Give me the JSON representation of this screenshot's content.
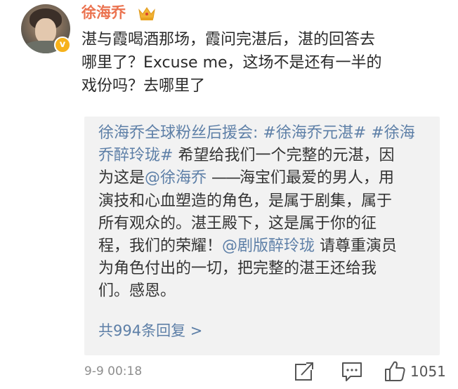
{
  "post": {
    "username": "徐海乔",
    "badge_icon": "crown-icon",
    "verified_icon": "verified-v-icon",
    "text_line1": "湛与霞喝酒那场，霞问完湛后，湛的回答去",
    "text_line2": "哪里了？Excuse me，这场不是还有一半的",
    "text_line3": "戏份吗？去哪里了"
  },
  "quoted": {
    "author": "徐海乔全球粉丝后援会:",
    "hashtag1": "#徐海乔元湛#",
    "hashtag2_part1": "#徐海",
    "hashtag2_part2": "乔醉玲珑#",
    "text_a": "希望给我们一个完整的元湛，因",
    "text_b": "为这是",
    "mention1": "@徐海乔",
    "dash": "——",
    "text_c": "海宝们最爱的男人，用",
    "text_d": "演技和心血塑造的角色，是属于剧集，属于",
    "text_e": "所有观众的。湛王殿下，这是属于你的征",
    "text_f": "程，我们的荣耀！",
    "mention2": "@剧版醉玲珑",
    "text_g": "请尊重演员",
    "text_h": "为角色付出的一切，把完整的湛王还给我",
    "text_i": "们。感恩。",
    "reply_count": "共994条回复 >"
  },
  "footer": {
    "timestamp": "9-9 00:18",
    "share_icon": "share-icon",
    "comment_icon": "comment-icon",
    "like_icon": "like-icon",
    "like_count": "1051"
  },
  "colors": {
    "username": "#eb7350",
    "link": "#5d7fa7",
    "text": "#2a2a2a",
    "card_bg": "#f2f2f2",
    "meta": "#8e8e8e"
  }
}
